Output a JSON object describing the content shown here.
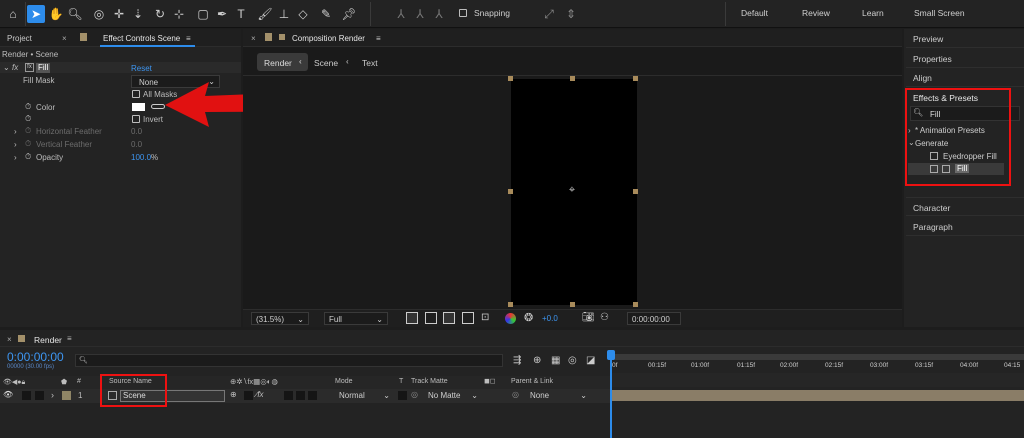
{
  "workspaces": [
    "Default",
    "Review",
    "Learn",
    "Small Screen"
  ],
  "toolbar": {
    "snapping_label": "Snapping"
  },
  "left_panel": {
    "tabs": [
      "Project",
      "Effect Controls Scene"
    ],
    "layer_path": "Render • Scene",
    "effect_name": "Fill",
    "reset_label": "Reset",
    "fill_mask_label": "Fill Mask",
    "fill_mask_value": "None",
    "all_masks_label": "All Masks",
    "color_label": "Color",
    "color_value": "#ffffff",
    "invert_label": "Invert",
    "horizontal_feather_label": "Horizontal Feather",
    "horizontal_feather_value": "0.0",
    "vertical_feather_label": "Vertical Feather",
    "vertical_feather_value": "0.0",
    "opacity_label": "Opacity",
    "opacity_value": "100.0",
    "opacity_unit": "%"
  },
  "composition": {
    "tab_title": "Composition Render",
    "breadcrumbs": [
      "Render",
      "Scene",
      "Text"
    ],
    "zoom": "(31.5%)",
    "resolution": "Full",
    "exposure": "+0.0",
    "timecode": "0:00:00:00"
  },
  "right_panel": {
    "items": [
      "Preview",
      "Properties",
      "Align"
    ],
    "effects_title": "Effects & Presets",
    "search_value": "Fill",
    "tree": {
      "animation_presets": "* Animation Presets",
      "generate": "Generate",
      "eyedropper_fill": "Eyedropper Fill",
      "fill": "Fill"
    },
    "bottom_items": [
      "Character",
      "Paragraph"
    ]
  },
  "timeline": {
    "tab_title": "Render",
    "timecode": "0:00:00:00",
    "fps_label": "00000 (30.00 fps)",
    "search_placeholder": "",
    "columns": {
      "num": "#",
      "source_name": "Source Name",
      "mode": "Mode",
      "t": "T",
      "track_matte": "Track Matte",
      "parent": "Parent & Link"
    },
    "layers": [
      {
        "num": "1",
        "name": "Scene",
        "mode": "Normal",
        "matte": "No Matte",
        "parent": "None"
      }
    ],
    "ruler": [
      "0f",
      "00:15f",
      "01:00f",
      "01:15f",
      "02:00f",
      "02:15f",
      "03:00f",
      "03:15f",
      "04:00f",
      "04:15"
    ]
  },
  "colors": {
    "accent": "#2d8ceb",
    "annotation_red": "#e11111",
    "bg": "#1d1d1d",
    "layer_bar": "#8a7d67"
  }
}
